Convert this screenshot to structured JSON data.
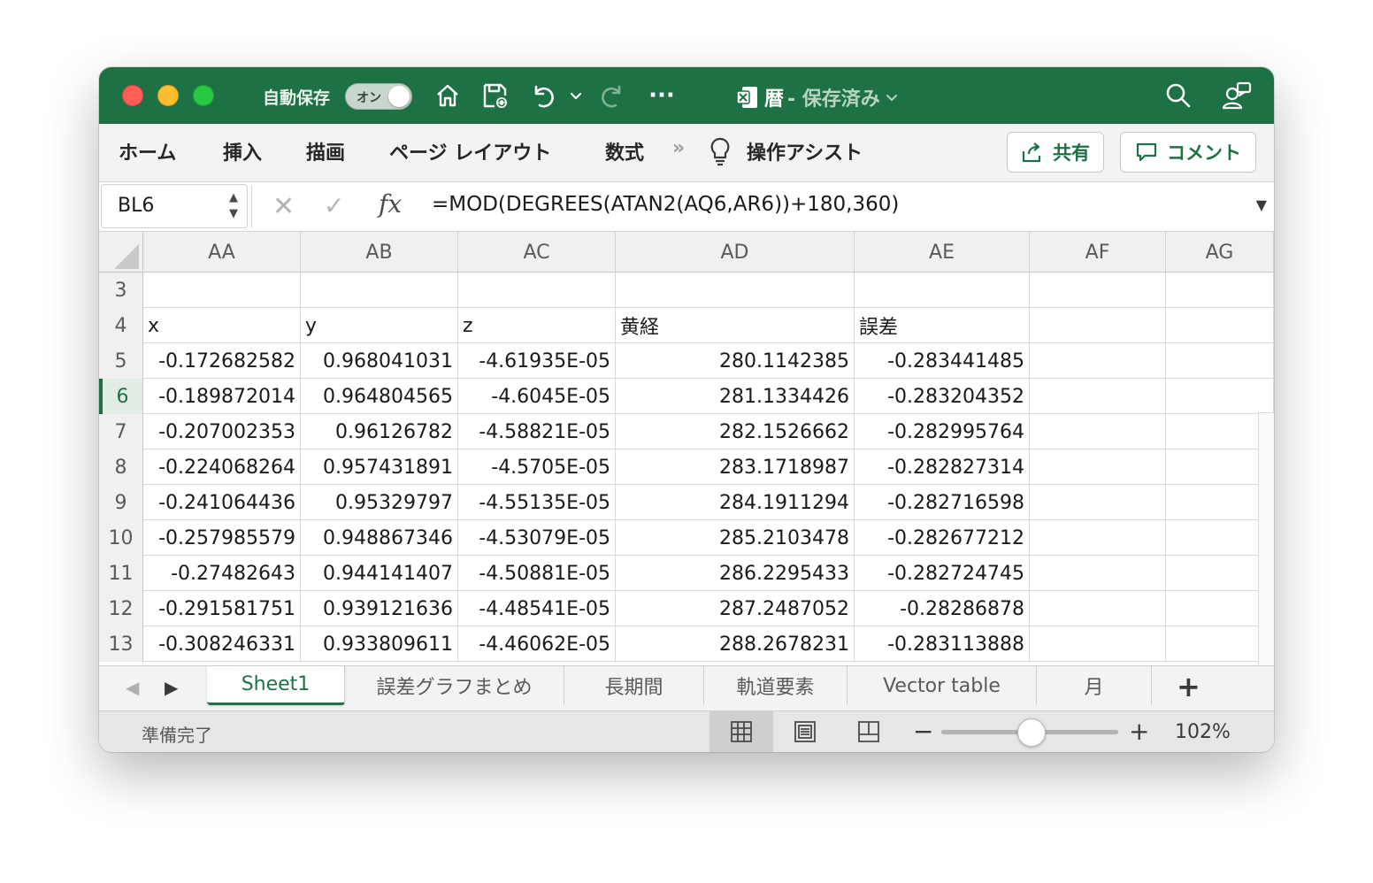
{
  "titlebar": {
    "autosave_label": "自動保存",
    "toggle_label": "オン",
    "more_label": "···",
    "doc_name": "暦",
    "doc_status": "- 保存済み",
    "accent": "#1e7145"
  },
  "ribbon": {
    "tabs": [
      "ホーム",
      "挿入",
      "描画",
      "ページ レイアウト",
      "数式"
    ],
    "overflow": "»",
    "assist": "操作アシスト",
    "share_label": "共有",
    "comment_label": "コメント"
  },
  "formula_bar": {
    "name_box": "BL6",
    "fx_label": "fx",
    "formula": "=MOD(DEGREES(ATAN2(AQ6,AR6))+180,360)"
  },
  "grid": {
    "columns": [
      "AA",
      "AB",
      "AC",
      "AD",
      "AE",
      "AF",
      "AG"
    ],
    "rows": [
      {
        "num": "3",
        "cells": [
          "",
          "",
          "",
          "",
          "",
          "",
          ""
        ]
      },
      {
        "num": "4",
        "cells": [
          "x",
          "y",
          "z",
          "黄経",
          "誤差",
          "",
          ""
        ]
      },
      {
        "num": "5",
        "cells": [
          "-0.172682582",
          "0.968041031",
          "-4.61935E-05",
          "280.1142385",
          "-0.283441485",
          "",
          ""
        ]
      },
      {
        "num": "6",
        "cells": [
          "-0.189872014",
          "0.964804565",
          "-4.6045E-05",
          "281.1334426",
          "-0.283204352",
          "",
          ""
        ]
      },
      {
        "num": "7",
        "cells": [
          "-0.207002353",
          "0.96126782",
          "-4.58821E-05",
          "282.1526662",
          "-0.282995764",
          "",
          ""
        ]
      },
      {
        "num": "8",
        "cells": [
          "-0.224068264",
          "0.957431891",
          "-4.5705E-05",
          "283.1718987",
          "-0.282827314",
          "",
          ""
        ]
      },
      {
        "num": "9",
        "cells": [
          "-0.241064436",
          "0.95329797",
          "-4.55135E-05",
          "284.1911294",
          "-0.282716598",
          "",
          ""
        ]
      },
      {
        "num": "10",
        "cells": [
          "-0.257985579",
          "0.948867346",
          "-4.53079E-05",
          "285.2103478",
          "-0.282677212",
          "",
          ""
        ]
      },
      {
        "num": "11",
        "cells": [
          "-0.27482643",
          "0.944141407",
          "-4.50881E-05",
          "286.2295433",
          "-0.282724745",
          "",
          ""
        ]
      },
      {
        "num": "12",
        "cells": [
          "-0.291581751",
          "0.939121636",
          "-4.48541E-05",
          "287.2487052",
          "-0.28286878",
          "",
          ""
        ]
      },
      {
        "num": "13",
        "cells": [
          "-0.308246331",
          "0.933809611",
          "-4.46062E-05",
          "288.2678231",
          "-0.283113888",
          "",
          ""
        ]
      }
    ],
    "active_row": "6"
  },
  "sheets": {
    "tabs": [
      "Sheet1",
      "誤差グラフまとめ",
      "長期間",
      "軌道要素",
      "Vector table",
      "月"
    ],
    "active": "Sheet1",
    "add_label": "+"
  },
  "status": {
    "text": "準備完了",
    "zoom_minus": "−",
    "zoom_plus": "+",
    "zoom": "102%",
    "zoom_fraction": 0.51
  }
}
